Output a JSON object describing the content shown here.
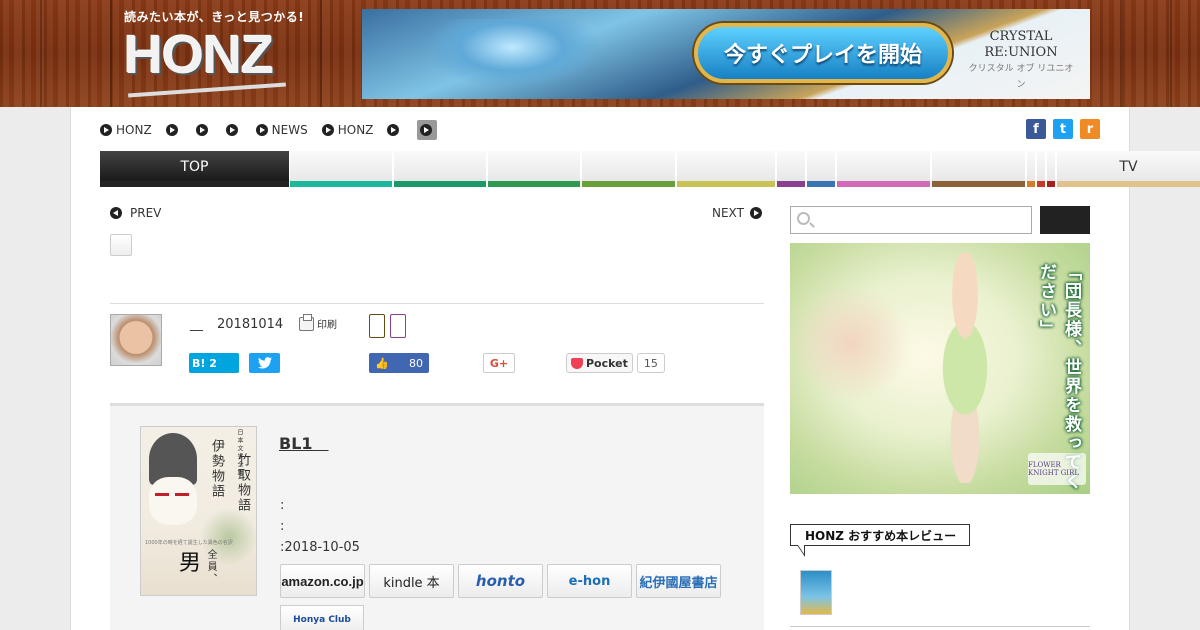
{
  "header": {
    "tagline": "読みたい本が、きっと見つかる!",
    "logo_text": "HONZ",
    "ad": {
      "button_label": "今すぐプレイを開始",
      "brand": "CRYSTAL RE:UNION",
      "brand_sub": "クリスタル オブ リユニオン"
    }
  },
  "topnav": {
    "items": [
      {
        "label": "HONZ"
      },
      {
        "label": ""
      },
      {
        "label": ""
      },
      {
        "label": ""
      },
      {
        "label": "NEWS"
      },
      {
        "label": "HONZ"
      },
      {
        "label": ""
      },
      {
        "label": ""
      }
    ]
  },
  "social": {
    "facebook": "f",
    "twitter": "t",
    "rss": "r"
  },
  "catnav": [
    {
      "label": "TOP",
      "color": "#222222"
    },
    {
      "label": "",
      "color": "#1bb89a"
    },
    {
      "label": "",
      "color": "#1a9a6a"
    },
    {
      "label": "",
      "color": "#2d9a52"
    },
    {
      "label": "",
      "color": "#6aa037"
    },
    {
      "label": "",
      "color": "#c9c255"
    },
    {
      "label": "",
      "color": "#8b3f8f"
    },
    {
      "label": "",
      "color": "#3a74b2"
    },
    {
      "label": "",
      "color": "#d26ab8"
    },
    {
      "label": "",
      "color": "#8c6238"
    },
    {
      "label": "",
      "color": "#d77b2b"
    },
    {
      "label": "",
      "color": "#c63a2c"
    },
    {
      "label": "",
      "color": "#a3221e"
    },
    {
      "label": "TV",
      "color": "#e0c28c"
    }
  ],
  "article": {
    "prev_label": "PREV",
    "next_label": "NEXT",
    "author": "__",
    "date": "20181014",
    "print_label": "印刷"
  },
  "share": {
    "hatena_count": "B! 2",
    "facebook_count": "80",
    "gplus_label": "G+",
    "pocket_label": "Pocket",
    "pocket_count": "15"
  },
  "book": {
    "title": "BL1　",
    "meta1": ":",
    "meta2": ":",
    "meta3": ":2018-10-05",
    "cover": {
      "series": "日本文学全集",
      "title_right": "竹取物語",
      "title_left": "伊勢物語",
      "big_text": "男",
      "big_sub": "全員、",
      "tagline": "1000年の時を経て誕生した異色の名訳"
    },
    "stores": [
      {
        "label": "amazon.co.jp"
      },
      {
        "label": "kindle 本"
      },
      {
        "label": "honto"
      },
      {
        "label": "e-hon"
      },
      {
        "label": "紀伊國屋書店"
      }
    ],
    "honya_label": "Honya Club"
  },
  "sidebar": {
    "search_placeholder": "",
    "ad_text": "「団長様、世界を救ってください」",
    "ad_brand": "FLOWER KNIGHT GIRL",
    "rec_title": "HONZ おすすめ本レビュー"
  }
}
